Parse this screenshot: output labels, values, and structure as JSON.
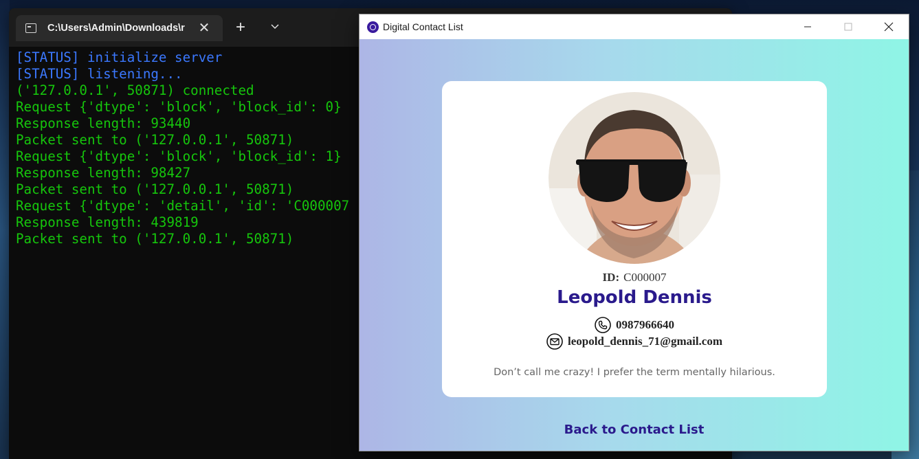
{
  "terminal": {
    "tab_title": "C:\\Users\\Admin\\Downloads\\r",
    "tab_close": "✕",
    "new_tab": "+",
    "lines": [
      {
        "text": "[STATUS] initialize server",
        "kind": "status"
      },
      {
        "text": "[STATUS] listening...",
        "kind": "status"
      },
      {
        "text": "('127.0.0.1', 50871) connected",
        "kind": "normal"
      },
      {
        "text": "Request {'dtype': 'block', 'block_id': 0}",
        "kind": "normal"
      },
      {
        "text": "Response length: 93440",
        "kind": "normal"
      },
      {
        "text": "Packet sent to ('127.0.0.1', 50871)",
        "kind": "normal"
      },
      {
        "text": "Request {'dtype': 'block', 'block_id': 1}",
        "kind": "normal"
      },
      {
        "text": "Response length: 98427",
        "kind": "normal"
      },
      {
        "text": "Packet sent to ('127.0.0.1', 50871)",
        "kind": "normal"
      },
      {
        "text": "Request {'dtype': 'detail', 'id': 'C000007",
        "kind": "normal"
      },
      {
        "text": "Response length: 439819",
        "kind": "normal"
      },
      {
        "text": "Packet sent to ('127.0.0.1', 50871)",
        "kind": "normal"
      }
    ]
  },
  "app": {
    "window_title": "Digital Contact List",
    "contact": {
      "id_label": "ID:",
      "id": "C000007",
      "name": "Leopold Dennis",
      "phone": "0987966640",
      "email": "leopold_dennis_71@gmail.com",
      "bio": "Don’t call me crazy! I prefer the term mentally hilarious."
    },
    "back_link": "Back to Contact List"
  },
  "colors": {
    "terminal_bg": "#0c0c0c",
    "terminal_green": "#16c60c",
    "terminal_blue": "#3b78ff",
    "name_color": "#2a1a8c",
    "gradient_left": "#adb6e6",
    "gradient_right": "#8ff5e6"
  },
  "icons": {
    "terminal_tab": "terminal-icon",
    "dropdown": "chevron-down-icon",
    "app_logo": "app-logo-icon",
    "minimize": "minimize-icon",
    "maximize": "maximize-icon",
    "close": "close-icon",
    "phone": "phone-icon",
    "email": "mail-icon"
  }
}
